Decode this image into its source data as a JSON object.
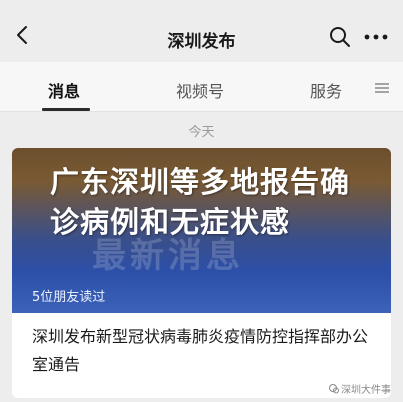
{
  "header": {
    "title": "深圳发布"
  },
  "tabs": [
    {
      "label": "消息",
      "active": true
    },
    {
      "label": "视频号",
      "active": false
    },
    {
      "label": "服务",
      "active": false
    }
  ],
  "date_label": "今天",
  "card": {
    "headline": "广东深圳等多地报告确诊病例和无症状感",
    "cover_watermark": "最新消息",
    "readers": "5位朋友读过",
    "article_title": "深圳发布新型冠状病毒肺炎疫情防控指挥部办公室通告"
  },
  "footer": {
    "source": "深圳大件事"
  },
  "colors": {
    "page_bg": "#ededed",
    "tab_bg": "#f7f7f7",
    "card_bg": "#ffffff",
    "cover_blue": "#2c4fa8",
    "cover_brown": "#6b4f2e"
  }
}
